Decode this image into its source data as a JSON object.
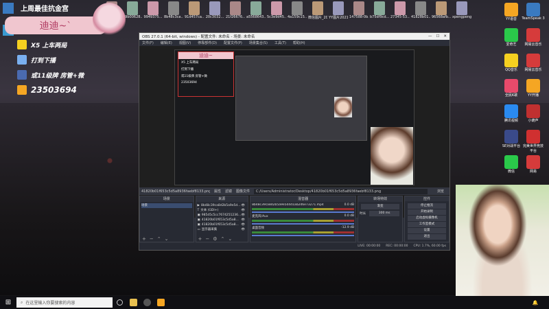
{
  "desktop": {
    "top_icons": [
      {
        "label": "YY语音"
      },
      {
        "label": "b9b00628..."
      },
      {
        "label": "9949375..."
      },
      {
        "label": "8b48c3ca..."
      },
      {
        "label": "91d457ca..."
      },
      {
        "label": "20c3032..."
      },
      {
        "label": "21f26676..."
      },
      {
        "label": "a5568643..."
      },
      {
        "label": "5c3e9d45..."
      },
      {
        "label": "4a159c15..."
      },
      {
        "label": "微信图片_2021070..."
      },
      {
        "label": "YY图片2021080..."
      },
      {
        "label": "147588-0b..."
      },
      {
        "label": "b75df9cd..."
      },
      {
        "label": "27345-53..."
      },
      {
        "label": "41828b01..."
      },
      {
        "label": "96568afb..."
      },
      {
        "label": "xpengpeng"
      }
    ],
    "right_icons": [
      {
        "label": "YY语音",
        "color": "#f5a623"
      },
      {
        "label": "TeamSpeak 3",
        "color": "#3a7ac0"
      },
      {
        "label": "爱奇艺",
        "color": "#2ac94a"
      },
      {
        "label": "网易云音乐",
        "color": "#d63b3b"
      },
      {
        "label": "QQ音乐",
        "color": "#f5d020"
      },
      {
        "label": "网易云音乐",
        "color": "#d63b3b"
      },
      {
        "label": "全民K歌",
        "color": "#e84a6b"
      },
      {
        "label": "YY开播",
        "color": "#f5a623"
      },
      {
        "label": "腾讯视频",
        "color": "#2a8af0"
      },
      {
        "label": "小葫芦",
        "color": "#c03030"
      },
      {
        "label": "SE对战平台",
        "color": "#3a4a8a"
      },
      {
        "label": "完美世界竞技平台",
        "color": "#d03030"
      },
      {
        "label": "微信",
        "color": "#2ac94a"
      },
      {
        "label": "网易",
        "color": "#d63b3b"
      }
    ]
  },
  "overlay": {
    "top_title": "上周最佳抗金宫",
    "streamer_name": "迪迪~`",
    "rules": [
      {
        "text": "X5  上车两局",
        "color": "#f5d020"
      },
      {
        "text": "打到下播",
        "color": "#7ab0f0"
      },
      {
        "text": "或11级牌  房管+微",
        "color": "#4a6ab0"
      },
      {
        "text": "23503694",
        "color": "#f5a623"
      }
    ]
  },
  "obs": {
    "title": "OBS 27.0.1 (64-bit, windows) - 配置文件: 未命名 - 场景: 未命名",
    "menu": [
      "文件(F)",
      "编辑(E)",
      "视图(V)",
      "停靠部件(D)",
      "配置文件(P)",
      "场景集合(S)",
      "工具(T)",
      "帮助(H)"
    ],
    "canvas_name": "迪迪~",
    "source_path": "41820b01f653c5d5a8936faebf8133.png",
    "props_label": "属性",
    "filters_label": "滤镜",
    "image_file_label": "图像文件",
    "image_path": "C:/Users/Administrator/Desktop/41820b01f653c5d5a8936faebf8133.png",
    "browse_label": "浏览",
    "docks": {
      "scenes": {
        "header": "场景",
        "items": [
          "场景"
        ]
      },
      "sources": {
        "header": "来源",
        "items": [
          "8b48c39ca8d2b5a9e5d...",
          "文本 (GDI+)",
          "985d5c5cc7674251236...",
          "41820b01f653c5d5a8...",
          "41820b01f653c5d5a8...",
          "显示器采集"
        ]
      },
      "mixer": {
        "header": "混音器",
        "tracks": [
          {
            "name": "8b48c39ca8d2b5a9e5d4d1ab2d6e73271.mp4",
            "db": "0.0 dB"
          },
          {
            "name": "麦克风/Aux",
            "db": "0.0 dB"
          },
          {
            "name": "桌面音频",
            "db": "-12.9 dB"
          }
        ]
      },
      "transitions": {
        "header": "转场特效",
        "type": "渐变",
        "duration_label": "时长",
        "duration": "300 ms"
      },
      "controls": {
        "header": "控件",
        "buttons": [
          "停止推流",
          "开始录制",
          "启动虚拟摄像机",
          "工作室模式",
          "设置",
          "退出"
        ]
      }
    },
    "status": {
      "live": "LIVE: 00:00:00",
      "rec": "REC: 00:00:00",
      "cpu": "CPU: 1.7%, 60.00 fps"
    }
  },
  "taskbar": {
    "search_placeholder": "在这里输入你要搜索的内容",
    "tray": "🔔"
  }
}
